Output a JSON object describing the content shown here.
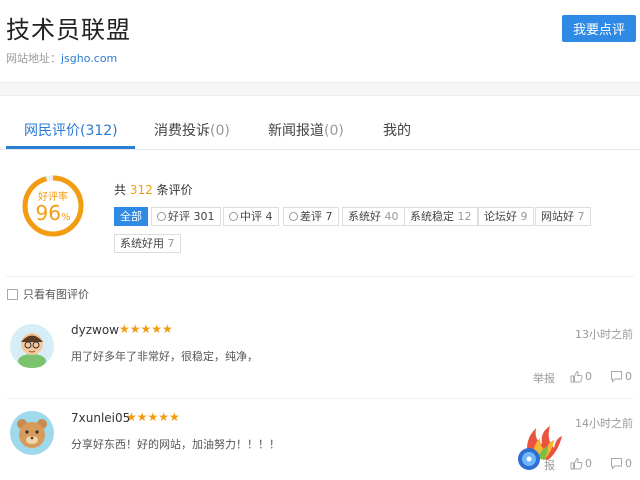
{
  "header": {
    "title": "技术员联盟",
    "url_label": "网站地址：",
    "url": "jsgho.com",
    "review_button": "我要点评"
  },
  "tabs": [
    {
      "label": "网民评价",
      "count": "(312)"
    },
    {
      "label": "消费投诉",
      "count": "(0)"
    },
    {
      "label": "新闻报道",
      "count": "(0)"
    },
    {
      "label": "我的",
      "count": ""
    }
  ],
  "summary": {
    "gauge_label": "好评率",
    "gauge_value": "96",
    "gauge_unit": "%",
    "gauge_fraction": 0.96,
    "total_prefix": "共",
    "total_count": "312",
    "total_suffix": "条评价"
  },
  "filters": [
    {
      "label": "全部",
      "count": ""
    },
    {
      "label": "好评",
      "count": "301"
    },
    {
      "label": "中评",
      "count": "4"
    },
    {
      "label": "差评",
      "count": "7"
    },
    {
      "label": "系统好",
      "count": "40"
    },
    {
      "label": "系统稳定",
      "count": "12"
    },
    {
      "label": "论坛好",
      "count": "9"
    },
    {
      "label": "网站好",
      "count": "7"
    },
    {
      "label": "系统好用",
      "count": "7"
    }
  ],
  "image_filter_label": "只看有图评价",
  "reviews": [
    {
      "user": "dyzwow",
      "stars": "★★★★★",
      "time": "13小时之前",
      "text": "用了好多年了非常好，很稳定，纯净，",
      "report": "举报",
      "likes": "0",
      "replies": "0"
    },
    {
      "user": "7xunlei05",
      "stars": "★★★★★",
      "time": "14小时之前",
      "text": "分享好东西！好的网站，加油努力！！！！",
      "report": "报",
      "likes": "0",
      "replies": "0"
    }
  ],
  "colors": {
    "accent": "#2b7cd3",
    "button": "#2f8ae5",
    "orange": "#f39c12"
  }
}
